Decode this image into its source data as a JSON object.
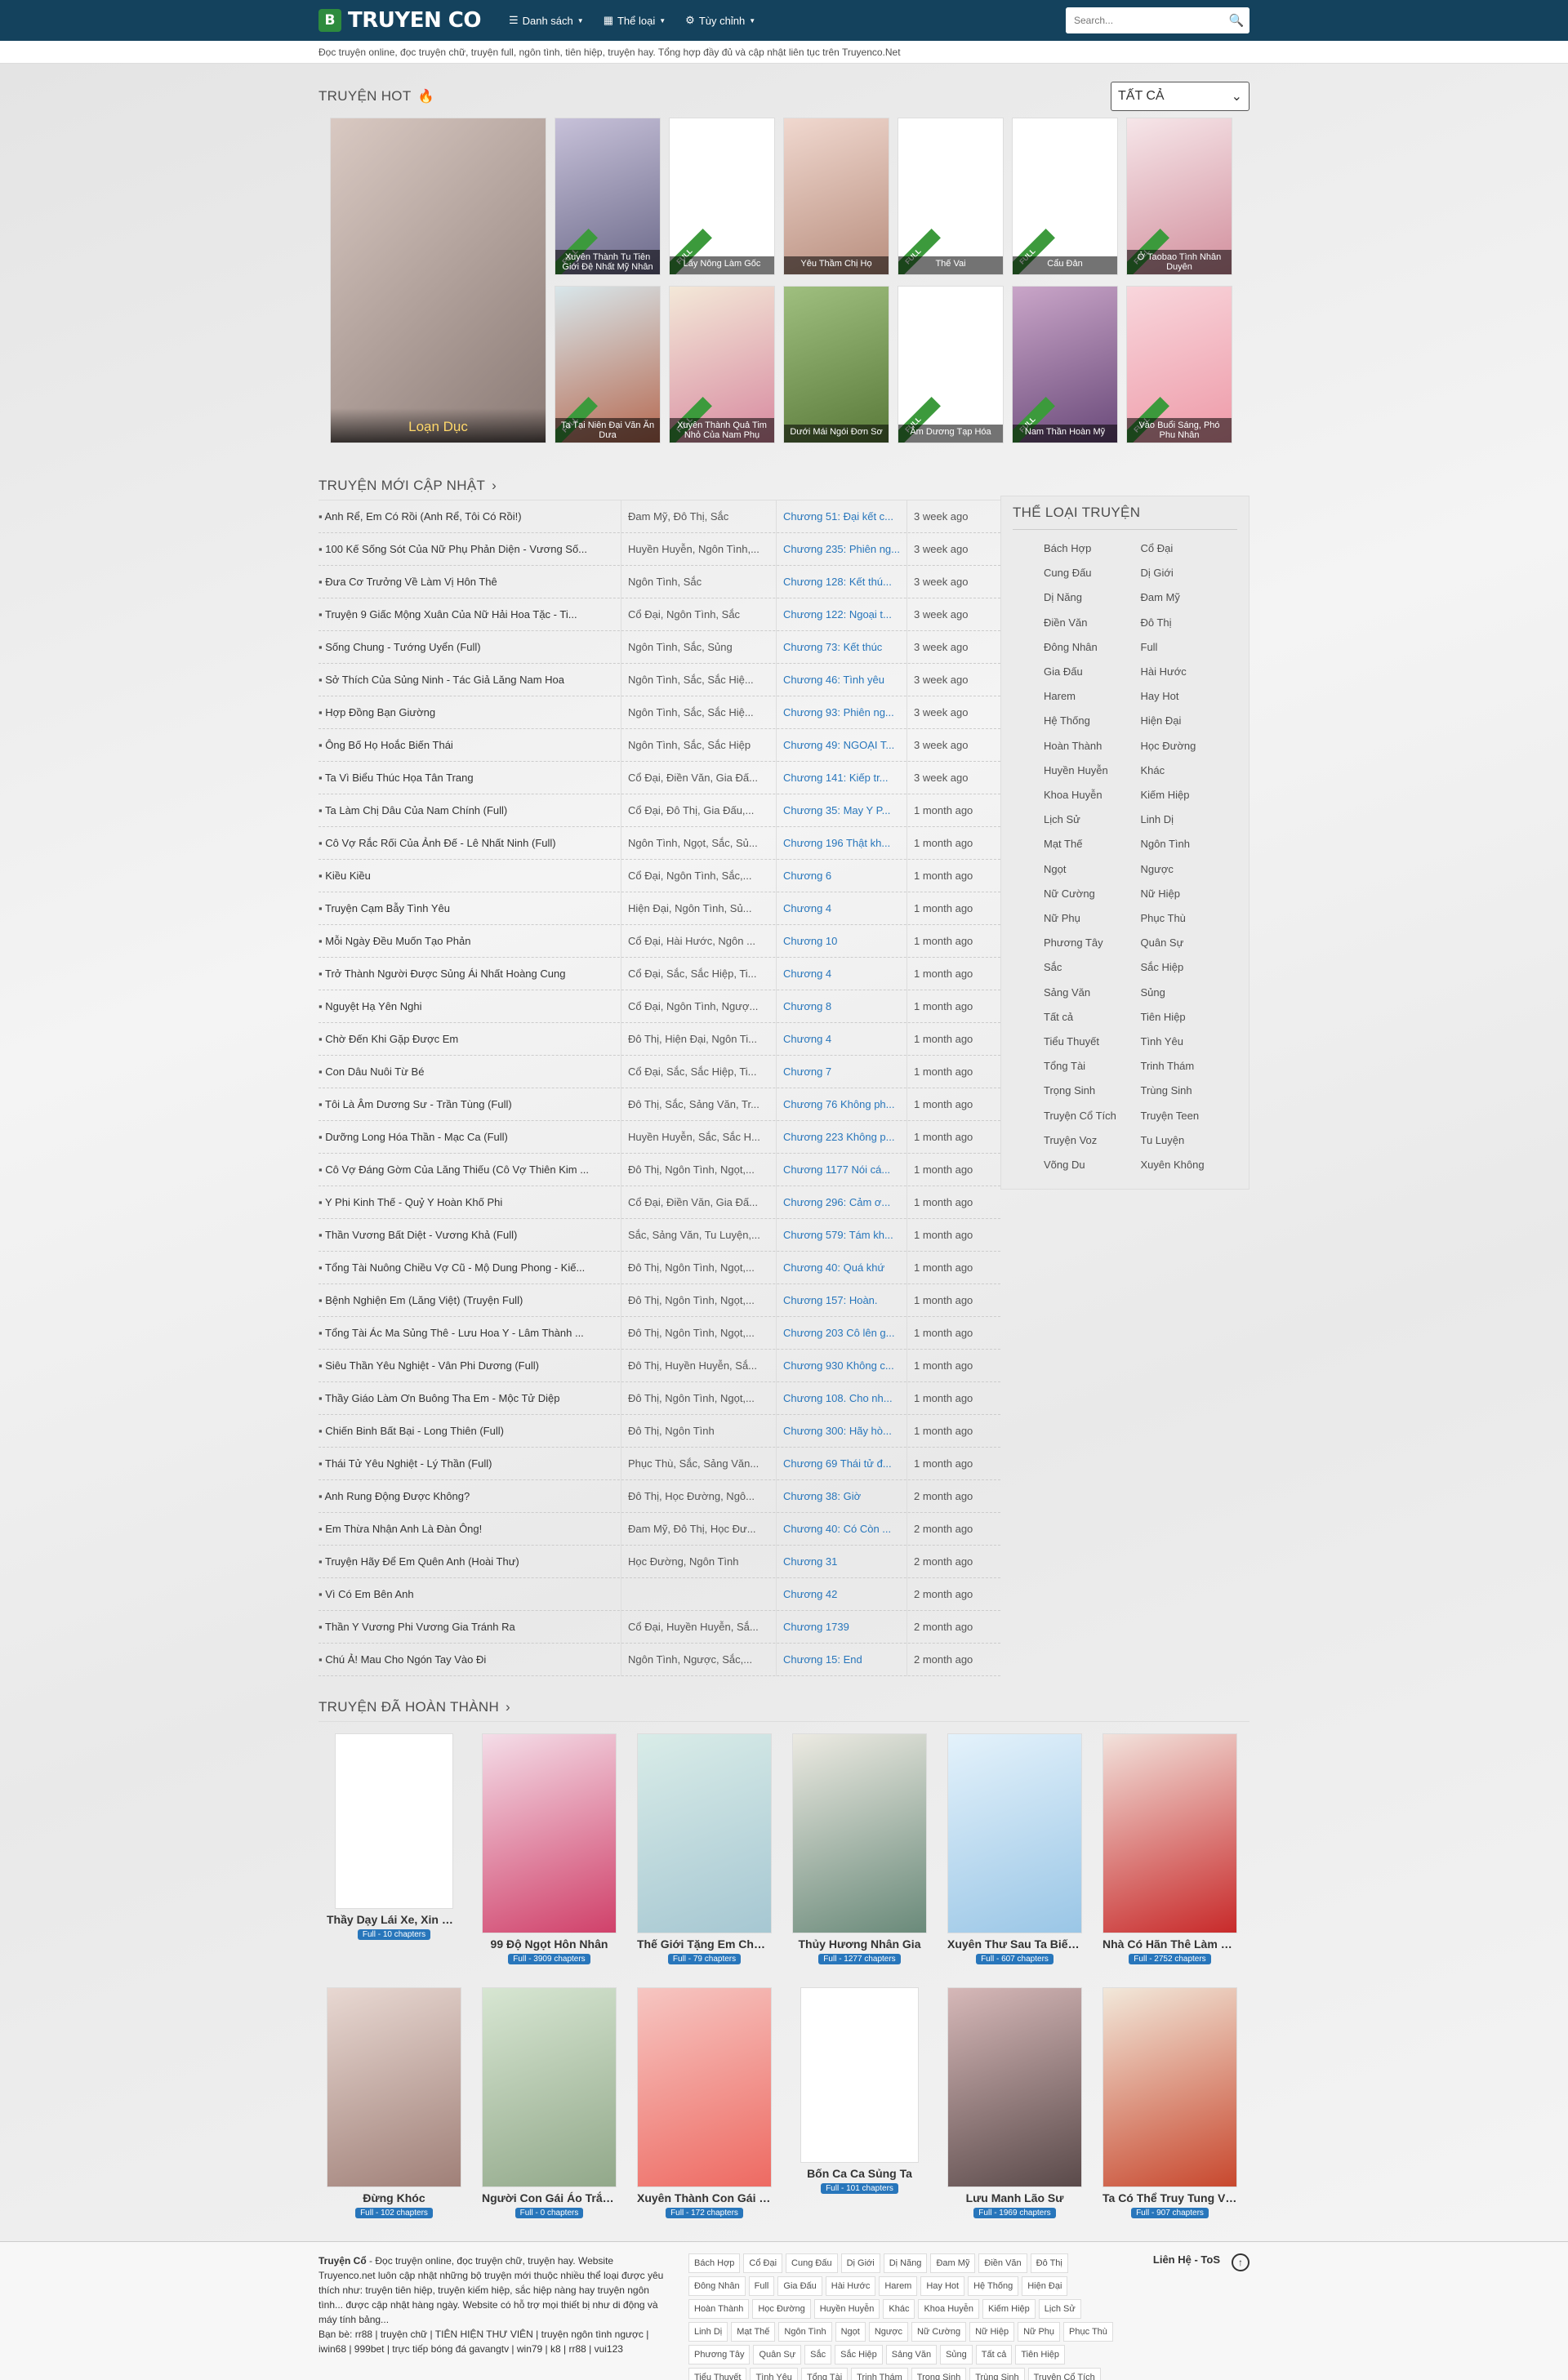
{
  "nav": {
    "logo_badge": "B",
    "logo_text": "TRUYEN CO",
    "menu": [
      {
        "icon": "☰",
        "label": "Danh sách"
      },
      {
        "icon": "▦",
        "label": "Thể loại"
      },
      {
        "icon": "⚙",
        "label": "Tùy chỉnh"
      }
    ],
    "search_placeholder": "Search...",
    "search_icon": "🔍"
  },
  "intro": "Đọc truyện online, đọc truyện chữ, truyện full, ngôn tình, tiên hiệp, truyện hay. Tổng hợp đầy đủ và cập nhật liên tục trên Truyenco.Net",
  "hot": {
    "title": "TRUYỆN HOT",
    "select_value": "TẤT CẢ",
    "big": {
      "caption": "Loạn Dục",
      "colors": [
        "#d9c9c2",
        "#8a7a75"
      ]
    },
    "items": [
      {
        "caption": "Xuyên Thành Tu Tiên Giới Đệ Nhất Mỹ Nhân",
        "full": true,
        "colors": [
          "#c7c1d9",
          "#6c6a8a"
        ]
      },
      {
        "caption": "Lấy Nông Làm Gốc",
        "full": true,
        "blank": true
      },
      {
        "caption": "Yêu Thầm Chị Họ",
        "full": false,
        "colors": [
          "#f0d8cf",
          "#b98f7f"
        ]
      },
      {
        "caption": "Thế Vai",
        "full": true,
        "blank": true
      },
      {
        "caption": "Cẩu Đản",
        "full": true,
        "blank": true
      },
      {
        "caption": "Ở Taobao Tình Nhân Duyên",
        "full": true,
        "colors": [
          "#f6e6e9",
          "#d28f9d"
        ]
      },
      {
        "caption": "Ta Tại Niên Đại Văn Ăn Dưa",
        "full": true,
        "colors": [
          "#d8e6ea",
          "#b66a52"
        ]
      },
      {
        "caption": "Xuyên Thành Quả Tim Nhỏ Của Nam Phụ",
        "full": true,
        "colors": [
          "#f3e8d8",
          "#d88aa0"
        ]
      },
      {
        "caption": "Dưới Mái Ngói Đơn Sơ",
        "full": false,
        "colors": [
          "#9fbf7f",
          "#5a7a3a"
        ]
      },
      {
        "caption": "Âm Dương Tạp Hóa",
        "full": true,
        "blank": true
      },
      {
        "caption": "Nam Thần Hoàn Mỹ",
        "full": true,
        "colors": [
          "#c9a5c8",
          "#6a4a7a"
        ]
      },
      {
        "caption": "Vào Buổi Sáng, Phó Phu Nhân",
        "full": true,
        "colors": [
          "#f8d6dc",
          "#ee9aa8"
        ]
      }
    ],
    "full_label": "FULL"
  },
  "latest": {
    "title": "TRUYỆN MỚI CẬP NHẬT",
    "rows": [
      [
        "Anh Rể, Em Có Rồi (Anh Rể, Tôi Có Rồi!)",
        "Đam Mỹ, Đô Thị, Sắc",
        "Chương 51: Đại kết c...",
        "3 week ago"
      ],
      [
        "100 Kế Sống Sót Của Nữ Phụ Phản Diện - Vương Số...",
        "Huyền Huyễn, Ngôn Tình,...",
        "Chương 235: Phiên ng...",
        "3 week ago"
      ],
      [
        "Đưa Cơ Trưởng Về Làm Vị Hôn Thê",
        "Ngôn Tình, Sắc",
        "Chương 128: Kết thú...",
        "3 week ago"
      ],
      [
        "Truyện 9 Giấc Mộng Xuân Của Nữ Hải Hoa Tặc - Ti...",
        "Cổ Đại, Ngôn Tình, Sắc",
        "Chương 122: Ngoại t...",
        "3 week ago"
      ],
      [
        "Sống Chung - Tướng Uyển (Full)",
        "Ngôn Tình, Sắc, Sủng",
        "Chương 73: Kết thúc",
        "3 week ago"
      ],
      [
        "Sở Thích Của Sủng Ninh - Tác Giả Lăng Nam Hoa",
        "Ngôn Tình, Sắc, Sắc Hiệ...",
        "Chương 46: Tình yêu",
        "3 week ago"
      ],
      [
        "Hợp Đồng Bạn Giường",
        "Ngôn Tình, Sắc, Sắc Hiệ...",
        "Chương 93: Phiên ng...",
        "3 week ago"
      ],
      [
        "Ông Bố Họ Hoắc Biến Thái",
        "Ngôn Tình, Sắc, Sắc Hiệp",
        "Chương 49: NGOẠI T...",
        "3 week ago"
      ],
      [
        "Ta Vì Biểu Thúc Họa Tân Trang",
        "Cổ Đại, Điền Văn, Gia Đấ...",
        "Chương 141: Kiếp tr...",
        "3 week ago"
      ],
      [
        "Ta Làm Chị Dâu Của Nam Chính (Full)",
        "Cổ Đại, Đô Thị, Gia Đấu,...",
        "Chương 35: May Y P...",
        "1 month ago"
      ],
      [
        "Cô Vợ Rắc Rối Của Ảnh Đế - Lê Nhất Ninh (Full)",
        "Ngôn Tình, Ngọt, Sắc, Sủ...",
        "Chương 196 Thật kh...",
        "1 month ago"
      ],
      [
        "Kiều Kiều",
        "Cổ Đại, Ngôn Tình, Sắc,...",
        "Chương 6",
        "1 month ago"
      ],
      [
        "Truyện Cạm Bẫy Tình Yêu",
        "Hiện Đại, Ngôn Tình, Sủ...",
        "Chương 4",
        "1 month ago"
      ],
      [
        "Mỗi Ngày Đều Muốn Tạo Phản",
        "Cổ Đại, Hài Hước, Ngôn ...",
        "Chương 10",
        "1 month ago"
      ],
      [
        "Trở Thành Người Được Sủng Ái Nhất Hoàng Cung",
        "Cổ Đại, Sắc, Sắc Hiệp, Ti...",
        "Chương 4",
        "1 month ago"
      ],
      [
        "Nguyệt Hạ Yên Nghi",
        "Cổ Đại, Ngôn Tình, Ngượ...",
        "Chương 8",
        "1 month ago"
      ],
      [
        "Chờ Đến Khi Gặp Được Em",
        "Đô Thị, Hiện Đại, Ngôn Ti...",
        "Chương 4",
        "1 month ago"
      ],
      [
        "Con Dâu Nuôi Từ Bé",
        "Cổ Đại, Sắc, Sắc Hiệp, Ti...",
        "Chương 7",
        "1 month ago"
      ],
      [
        "Tôi Là Âm Dương Sư - Trần Tùng (Full)",
        "Đô Thị, Sắc, Sảng Văn, Tr...",
        "Chương 76 Không ph...",
        "1 month ago"
      ],
      [
        "Dưỡng Long Hóa Thần - Mạc Ca (Full)",
        "Huyền Huyễn, Sắc, Sắc H...",
        "Chương 223 Không p...",
        "1 month ago"
      ],
      [
        "Cô Vợ Đáng Gờm Của Lăng Thiếu (Cô Vợ Thiên Kim ...",
        "Đô Thị, Ngôn Tình, Ngọt,...",
        "Chương 1177 Nói cá...",
        "1 month ago"
      ],
      [
        "Y Phi Kinh Thế - Quỷ Y Hoàn Khố Phi",
        "Cổ Đại, Điền Văn, Gia Đấ...",
        "Chương 296: Cảm ơ...",
        "1 month ago"
      ],
      [
        "Thần Vương Bất Diệt - Vương Khả (Full)",
        "Sắc, Sảng Văn, Tu Luyện,...",
        "Chương 579: Tám kh...",
        "1 month ago"
      ],
      [
        "Tổng Tài Nuông Chiều Vợ Cũ - Mộ Dung Phong - Kiế...",
        "Đô Thị, Ngôn Tình, Ngọt,...",
        "Chương 40: Quá khứ",
        "1 month ago"
      ],
      [
        "Bệnh Nghiện Em (Lăng Việt) (Truyện Full)",
        "Đô Thị, Ngôn Tình, Ngọt,...",
        "Chương 157: Hoàn.",
        "1 month ago"
      ],
      [
        "Tổng Tài Ác Ma Sủng Thê - Lưu Hoa Y - Lâm Thành ...",
        "Đô Thị, Ngôn Tình, Ngọt,...",
        "Chương 203 Cô lên g...",
        "1 month ago"
      ],
      [
        "Siêu Thần Yêu Nghiệt - Vân Phi Dương (Full)",
        "Đô Thị, Huyền Huyễn, Sắ...",
        "Chương 930 Không c...",
        "1 month ago"
      ],
      [
        "Thầy Giáo Làm Ơn Buông Tha Em - Mộc Tử Diệp",
        "Đô Thị, Ngôn Tình, Ngọt,...",
        "Chương 108. Cho nh...",
        "1 month ago"
      ],
      [
        "Chiến Binh Bất Bại - Long Thiên (Full)",
        "Đô Thị, Ngôn Tình",
        "Chương 300: Hãy hò...",
        "1 month ago"
      ],
      [
        "Thái Tử Yêu Nghiệt - Lý Thần (Full)",
        "Phục Thù, Sắc, Sảng Văn...",
        "Chương 69 Thái tử đ...",
        "1 month ago"
      ],
      [
        "Anh Rung Động Được Không?",
        "Đô Thị, Học Đường, Ngô...",
        "Chương 38: Giờ",
        "2 month ago"
      ],
      [
        "Em Thừa Nhận Anh Là Đàn Ông!",
        "Đam Mỹ, Đô Thị, Học Đư...",
        "Chương 40: Có Còn ...",
        "2 month ago"
      ],
      [
        "Truyện Hãy Để Em Quên Anh (Hoài Thư)",
        "Học Đường, Ngôn Tình",
        "Chương 31",
        "2 month ago"
      ],
      [
        "Vì Có Em Bên Anh",
        "",
        "Chương 42",
        "2 month ago"
      ],
      [
        "Thần Y Vương Phi Vương Gia Tránh Ra",
        "Cổ Đại, Huyền Huyễn, Sắ...",
        "Chương 1739",
        "2 month ago"
      ],
      [
        "Chú Ả! Mau Cho Ngón Tay Vào Đi",
        "Ngôn Tình, Ngược, Sắc,...",
        "Chương 15: End",
        "2 month ago"
      ]
    ]
  },
  "genres": {
    "title": "THỂ LOẠI TRUYỆN",
    "items": [
      "Bách Hợp",
      "Cổ Đại",
      "Cung Đấu",
      "Dị Giới",
      "Dị Năng",
      "Đam Mỹ",
      "Điền Văn",
      "Đô Thị",
      "Đông Nhân",
      "Full",
      "Gia Đấu",
      "Hài Hước",
      "Harem",
      "Hay Hot",
      "Hệ Thống",
      "Hiện Đại",
      "Hoàn Thành",
      "Học Đường",
      "Huyền Huyễn",
      "Khác",
      "Khoa Huyễn",
      "Kiếm Hiệp",
      "Lịch Sử",
      "Linh Dị",
      "Mạt Thế",
      "Ngôn Tình",
      "Ngọt",
      "Ngược",
      "Nữ Cường",
      "Nữ Hiệp",
      "Nữ Phụ",
      "Phục Thù",
      "Phương Tây",
      "Quân Sự",
      "Sắc",
      "Sắc Hiệp",
      "Sảng Văn",
      "Sủng",
      "Tất cả",
      "Tiên Hiệp",
      "Tiểu Thuyết",
      "Tình Yêu",
      "Tổng Tài",
      "Trinh Thám",
      "Trọng Sinh",
      "Trùng Sinh",
      "Truyện Cổ Tích",
      "Truyện Teen",
      "Truyện Voz",
      "Tu Luyện",
      "Võng Du",
      "Xuyên Không"
    ]
  },
  "completed": {
    "title": "TRUYỆN ĐÃ HOÀN THÀNH",
    "items": [
      {
        "title": "Thầy Dạy Lái Xe, Xin Giúp ...",
        "badge": "Full - 10 chapters",
        "blank": true
      },
      {
        "title": "99 Độ Ngọt Hôn Nhân",
        "badge": "Full - 3909 chapters",
        "colors": [
          "#f4dde8",
          "#d0416a"
        ]
      },
      {
        "title": "Thế Giới Tặng Em Cho Anh",
        "badge": "Full - 79 chapters",
        "colors": [
          "#d9ece8",
          "#a6c7d2"
        ]
      },
      {
        "title": "Thủy Hương Nhân Gia",
        "badge": "Full - 1277 chapters",
        "colors": [
          "#eceae2",
          "#6a8a7a"
        ]
      },
      {
        "title": "Xuyên Thư Sau Ta Biến Đo...",
        "badge": "Full - 607 chapters",
        "colors": [
          "#e4f2fb",
          "#9ac6e6"
        ]
      },
      {
        "title": "Nhà Có Hãn Thê Làm Sao ...",
        "badge": "Full - 2752 chapters",
        "colors": [
          "#f2e2dc",
          "#c82a2a"
        ]
      },
      {
        "title": "Đừng Khóc",
        "badge": "Full - 102 chapters",
        "colors": [
          "#e8d8d2",
          "#a08078"
        ]
      },
      {
        "title": "Người Con Gái Áo Trắng T...",
        "badge": "Full - 0 chapters",
        "colors": [
          "#d7e6d2",
          "#92a88a"
        ]
      },
      {
        "title": "Xuyên Thành Con Gái Của ...",
        "badge": "Full - 172 chapters",
        "colors": [
          "#f6c6c2",
          "#ee6a62"
        ]
      },
      {
        "title": "Bốn Ca Ca Sủng Ta",
        "badge": "Full - 101 chapters",
        "blank": true
      },
      {
        "title": "Lưu Manh Lão Sư",
        "badge": "Full - 1969 chapters",
        "colors": [
          "#d6b8b8",
          "#5a4a4a"
        ]
      },
      {
        "title": "Ta Có Thể Truy Tung Vạn ...",
        "badge": "Full - 907 chapters",
        "colors": [
          "#f2e8da",
          "#c8482e"
        ]
      }
    ]
  },
  "footer": {
    "about_brand": "Truyện Cổ",
    "about_text": " - Đọc truyện online, đọc truyện chữ, truyện hay. Website Truyenco.net luôn cập nhật những bộ truyện mới thuộc nhiều thể loại được yêu thích như: truyện tiên hiệp, truyện kiếm hiệp, sắc hiệp nàng hay truyện ngôn tình... được cập nhật hàng ngày. Website có hỗ trợ mọi thiết bị như di động và máy tính bảng...",
    "friends": "Bạn bè: rr88 | truyện chữ | TIÊN HIỆN THƯ VIÊN | truyện ngôn tình ngược | iwin68 | 999bet | trực tiếp bóng đá gavangtv | win79 | k8 | rr88 | vui123",
    "contact": "Liên Hệ - ToS",
    "totop": "↑"
  }
}
